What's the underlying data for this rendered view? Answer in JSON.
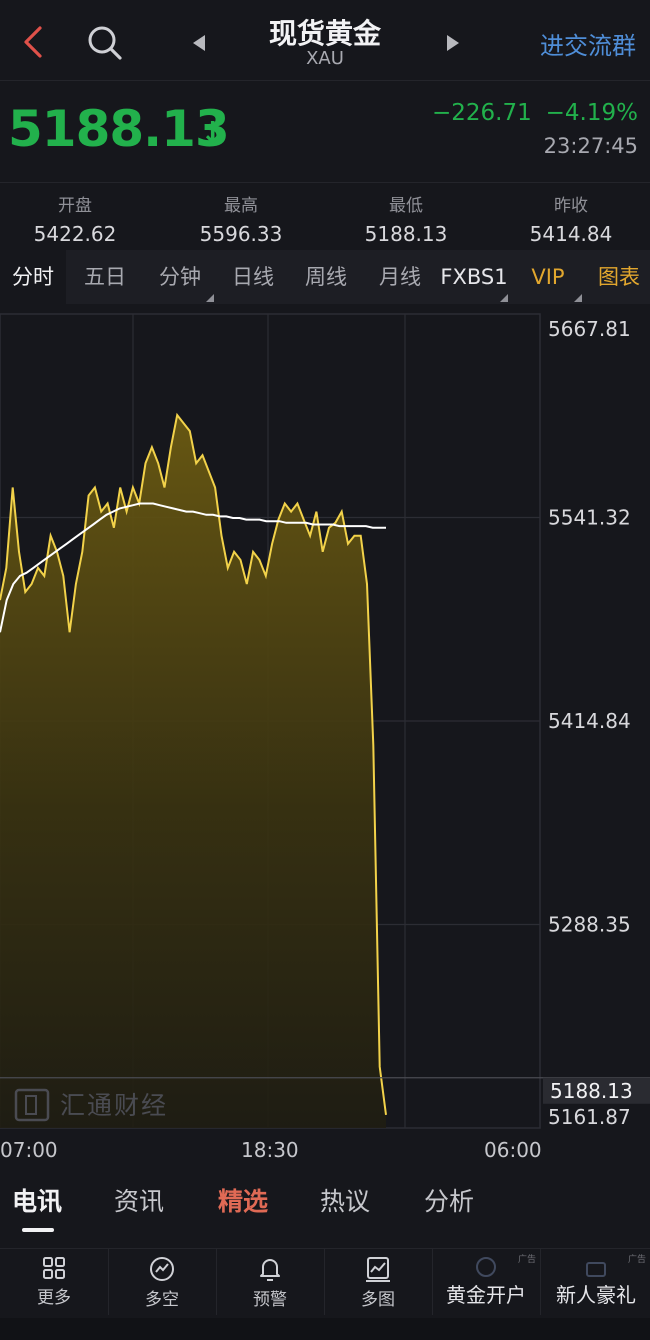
{
  "header": {
    "title": "现货黄金",
    "subtitle": "XAU",
    "join_link": "进交流群"
  },
  "quote": {
    "price": "5188.13",
    "direction": "down",
    "change": "−226.71",
    "change_pct": "−4.19%",
    "time": "23:27:45"
  },
  "stats": [
    {
      "label": "开盘",
      "value": "5422.62"
    },
    {
      "label": "最高",
      "value": "5596.33"
    },
    {
      "label": "最低",
      "value": "5188.13"
    },
    {
      "label": "昨收",
      "value": "5414.84"
    }
  ],
  "tabs": [
    {
      "label": "分时",
      "active": true
    },
    {
      "label": "五日"
    },
    {
      "label": "分钟",
      "dropdown": true
    },
    {
      "label": "日线"
    },
    {
      "label": "周线"
    },
    {
      "label": "月线"
    },
    {
      "label": "FXBS1",
      "dropdown": true
    },
    {
      "label": "VIP",
      "dropdown": true
    },
    {
      "label": "图表"
    }
  ],
  "colors": {
    "up": "#22b14c",
    "down": "#22b14c",
    "accent": "#4f8ed8",
    "gold": "#e2a72e",
    "price_line": "#f2d24a",
    "avg_line": "#ffffff",
    "highlight_tab": "#e06a55"
  },
  "chart_data": {
    "type": "area",
    "y_ticks": [
      "5667.81",
      "5541.32",
      "5414.84",
      "5288.35",
      "5161.87"
    ],
    "last_price_tag": "5188.13",
    "ylim": [
      5161.87,
      5667.81
    ],
    "x_ticks": [
      "07:00",
      "18:30",
      "06:00"
    ],
    "series": [
      {
        "values": [
          5490,
          5510,
          5560,
          5520,
          5495,
          5500,
          5510,
          5505,
          5530,
          5520,
          5505,
          5470,
          5500,
          5520,
          5555,
          5560,
          5545,
          5550,
          5535,
          5560,
          5545,
          5560,
          5550,
          5575,
          5585,
          5575,
          5560,
          5585,
          5605,
          5600,
          5595,
          5575,
          5580,
          5570,
          5560,
          5530,
          5510,
          5520,
          5515,
          5500,
          5520,
          5515,
          5505,
          5525,
          5540,
          5550,
          5545,
          5550,
          5540,
          5530,
          5545,
          5520,
          5535,
          5538,
          5545,
          5525,
          5530,
          5530,
          5500,
          5400,
          5200,
          5170
        ],
        "color": "#f2d24a"
      },
      {
        "values": [
          5470,
          5490,
          5500,
          5505,
          5507,
          5510,
          5513,
          5516,
          5519,
          5522,
          5525,
          5528,
          5531,
          5534,
          5537,
          5540,
          5543,
          5545,
          5547,
          5548,
          5549,
          5550,
          5550,
          5550,
          5549,
          5548,
          5547,
          5546,
          5545,
          5545,
          5544,
          5543,
          5543,
          5542,
          5542,
          5541,
          5541,
          5540,
          5540,
          5540,
          5539,
          5539,
          5539,
          5538,
          5538,
          5538,
          5538,
          5537,
          5537,
          5537,
          5537,
          5536,
          5536,
          5536,
          5536,
          5536,
          5535,
          5535,
          5535
        ],
        "color": "#ffffff"
      }
    ]
  },
  "watermark": "汇通财经",
  "news_tabs": [
    {
      "label": "电讯",
      "active": true
    },
    {
      "label": "资讯"
    },
    {
      "label": "精选",
      "highlight": true
    },
    {
      "label": "热议"
    },
    {
      "label": "分析"
    }
  ],
  "bottom_bar": [
    {
      "label": "更多",
      "icon": "grid-icon"
    },
    {
      "label": "多空",
      "icon": "bull-bear-icon"
    },
    {
      "label": "预警",
      "icon": "bell-icon"
    },
    {
      "label": "多图",
      "icon": "multi-chart-icon"
    },
    {
      "label": "黄金开户",
      "icon": "account-icon",
      "ad": "广告"
    },
    {
      "label": "新人豪礼",
      "icon": "gift-icon",
      "ad": "广告"
    }
  ]
}
